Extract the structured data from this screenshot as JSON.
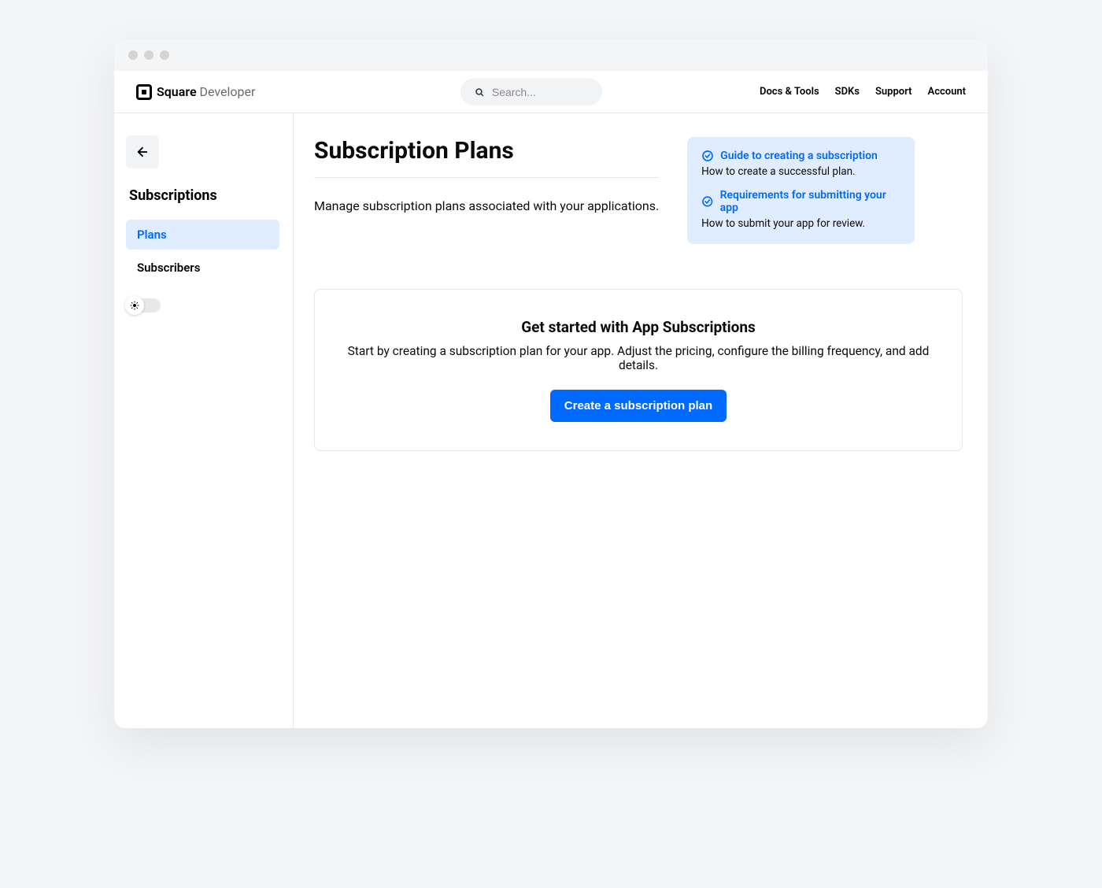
{
  "header": {
    "logo_primary": "Square",
    "logo_secondary": "Developer",
    "search_placeholder": "Search...",
    "nav": [
      "Docs & Tools",
      "SDKs",
      "Support",
      "Account"
    ]
  },
  "sidebar": {
    "title": "Subscriptions",
    "items": [
      {
        "label": "Plans",
        "active": true
      },
      {
        "label": "Subscribers",
        "active": false
      }
    ]
  },
  "page": {
    "title": "Subscription Plans",
    "subtitle": "Manage subscription plans associated with your applications."
  },
  "cta": {
    "title": "Get started with App Subscriptions",
    "desc": "Start by creating a subscription plan for your app. Adjust the pricing, configure the billing frequency, and add details.",
    "button": "Create a subscription plan"
  },
  "info": {
    "items": [
      {
        "link": "Guide to creating a subscription",
        "desc": "How to create a successful plan."
      },
      {
        "link": "Requirements for submitting your app",
        "desc": "How to submit your app for review."
      }
    ]
  }
}
